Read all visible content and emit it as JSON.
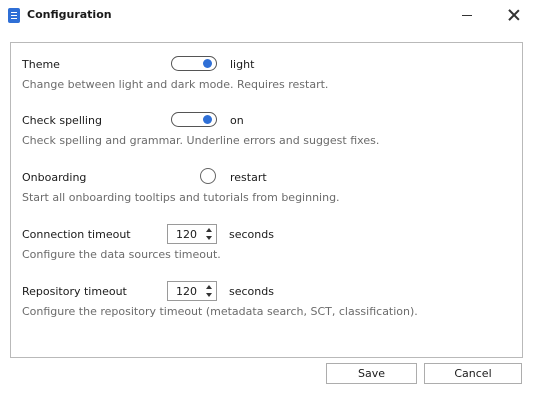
{
  "window": {
    "title": "Configuration",
    "icon": "app-document-icon",
    "minimize_icon": "minimize-icon",
    "close_icon": "close-icon"
  },
  "settings": {
    "theme": {
      "label": "Theme",
      "control": "toggle",
      "enabled": true,
      "value_text": "light",
      "description": "Change between light and dark mode. Requires restart."
    },
    "check_spelling": {
      "label": "Check spelling",
      "control": "toggle",
      "enabled": true,
      "value_text": "on",
      "description": "Check spelling and grammar. Underline errors and suggest fixes."
    },
    "onboarding": {
      "label": "Onboarding",
      "control": "radio",
      "selected": false,
      "value_text": "restart",
      "description": "Start all onboarding tooltips and tutorials from beginning."
    },
    "connection_timeout": {
      "label": "Connection timeout",
      "value": "120",
      "unit": "seconds",
      "description": "Configure the data sources timeout."
    },
    "repository_timeout": {
      "label": "Repository timeout",
      "value": "120",
      "unit": "seconds",
      "description": "Configure the repository timeout (metadata search, SCT, classification)."
    }
  },
  "buttons": {
    "save": "Save",
    "cancel": "Cancel"
  },
  "colors": {
    "accent": "#2f6fd6",
    "border": "#b9b9b9",
    "description_text": "#6b6b6b"
  }
}
